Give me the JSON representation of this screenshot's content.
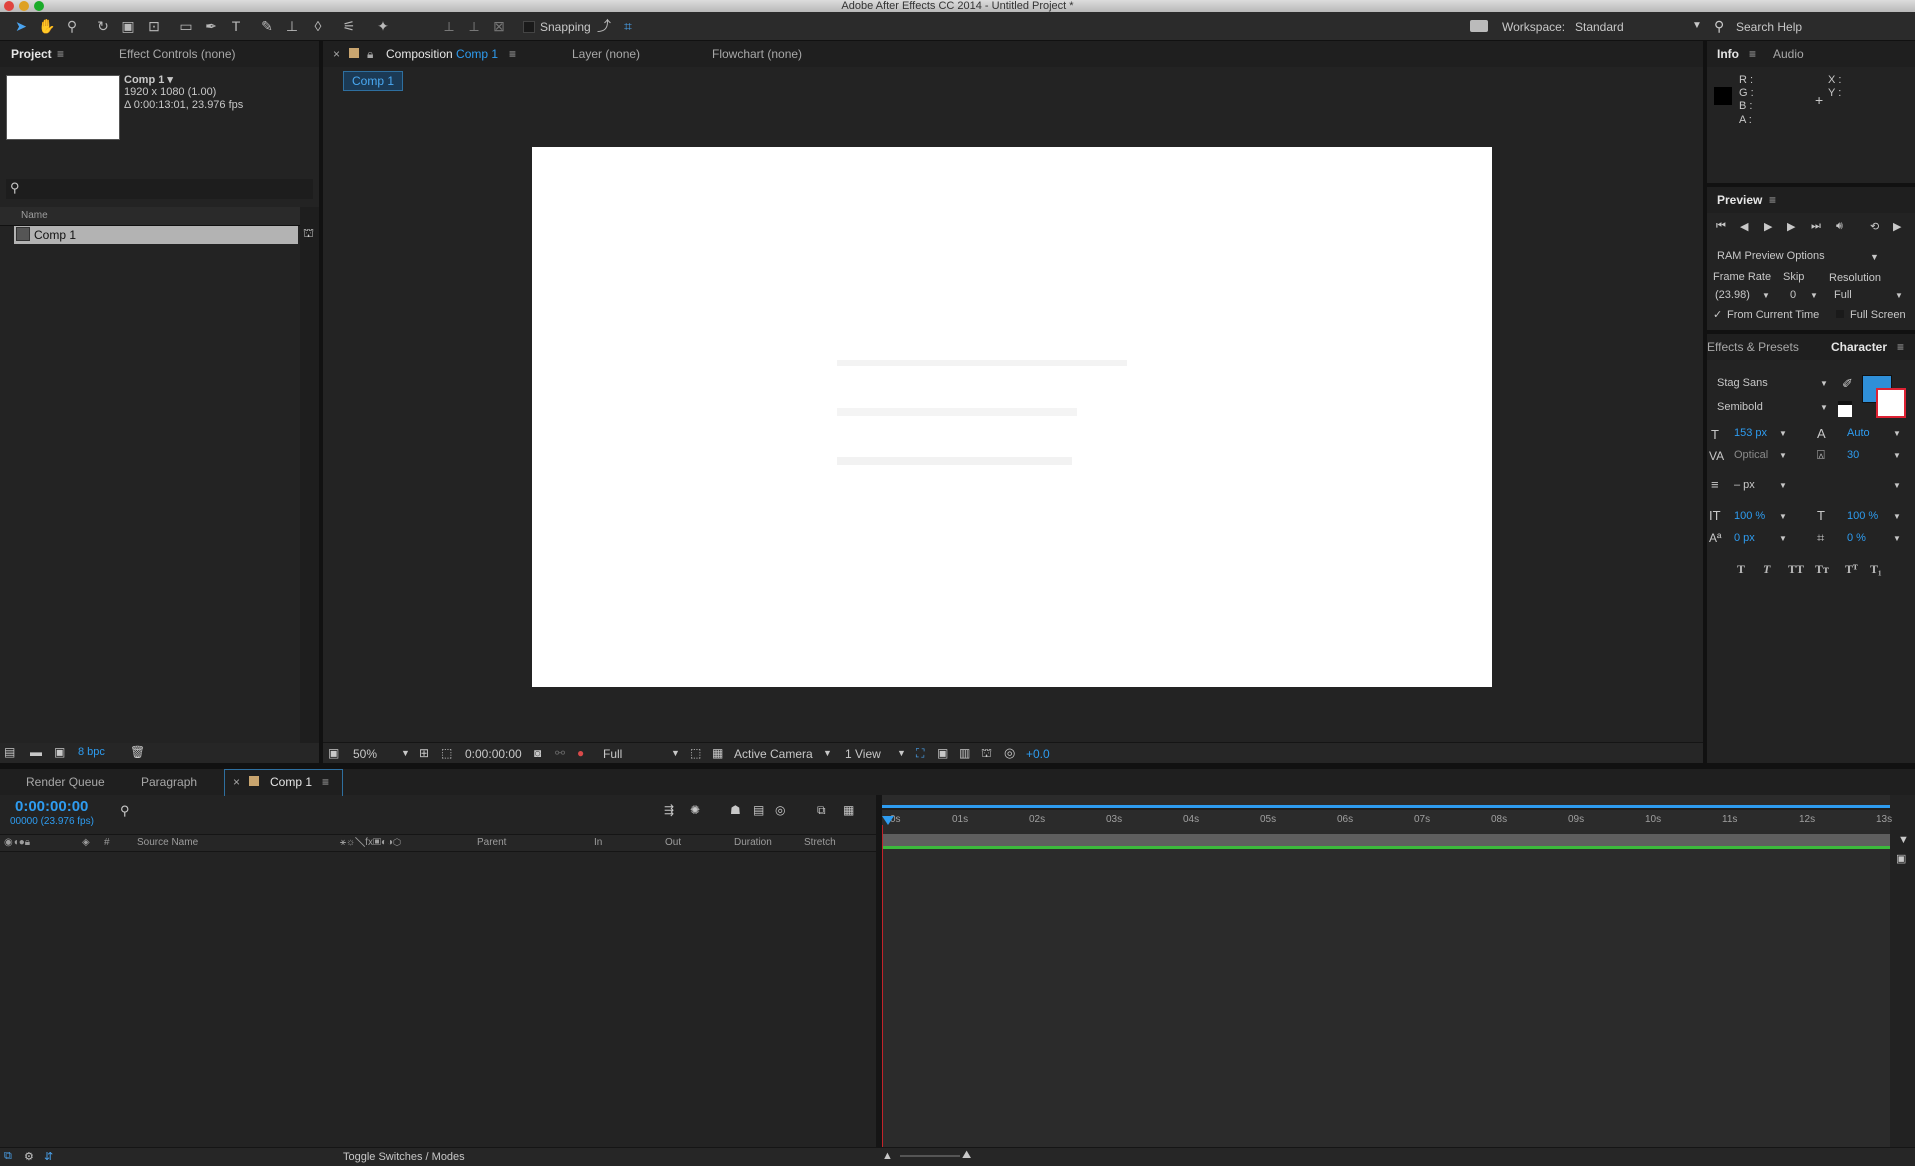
{
  "app": {
    "title": "Adobe After Effects CC 2014 - Untitled Project *"
  },
  "toolbar": {
    "snapping_label": "Snapping",
    "workspace_label": "Workspace:",
    "workspace_value": "Standard",
    "search_help": "Search Help"
  },
  "project": {
    "tab_project": "Project",
    "tab_effect_controls": "Effect Controls (none)",
    "comp_name": "Comp 1 ▾",
    "comp_res": "1920 x 1080 (1.00)",
    "comp_duration": "Δ 0:00:13:01, 23.976 fps",
    "column_name": "Name",
    "items": [
      "Comp 1"
    ],
    "bpc": "8 bpc"
  },
  "viewer": {
    "tab_composition_prefix": "Composition",
    "tab_composition_name": "Comp 1",
    "tab_layer": "Layer (none)",
    "tab_flowchart": "Flowchart (none)",
    "breadcrumb": "Comp 1",
    "zoom": "50%",
    "timecode": "0:00:00:00",
    "resolution": "Full",
    "camera": "Active Camera",
    "views": "1 View",
    "exposure": "+0.0"
  },
  "info": {
    "tab_info": "Info",
    "tab_audio": "Audio",
    "r": "R :",
    "g": "G :",
    "b": "B :",
    "a": "A :",
    "x": "X :",
    "y": "Y :"
  },
  "preview": {
    "title": "Preview",
    "ram_options": "RAM Preview Options",
    "frame_rate_label": "Frame Rate",
    "skip_label": "Skip",
    "resolution_label": "Resolution",
    "frame_rate_value": "(23.98)",
    "skip_value": "0",
    "resolution_value": "Full",
    "from_current": "From Current Time",
    "full_screen": "Full Screen"
  },
  "character": {
    "tab_effects": "Effects & Presets",
    "tab_character": "Character",
    "font": "Stag Sans",
    "style": "Semibold",
    "size": "153 px",
    "leading": "Auto",
    "kerning": "Optical",
    "tracking": "30",
    "stroke": "– px",
    "vscale": "100 %",
    "hscale": "100 %",
    "baseline": "0 px",
    "tsume": "0 %",
    "fill_color": "#2f8fd8"
  },
  "timeline": {
    "tab_render_queue": "Render Queue",
    "tab_paragraph": "Paragraph",
    "tab_comp": "Comp 1",
    "timecode": "0:00:00:00",
    "frames": "00000 (23.976 fps)",
    "col_source": "Source Name",
    "col_parent": "Parent",
    "col_in": "In",
    "col_out": "Out",
    "col_duration": "Duration",
    "col_stretch": "Stretch",
    "toggle_label": "Toggle Switches / Modes",
    "ruler": [
      "0s",
      "01s",
      "02s",
      "03s",
      "04s",
      "05s",
      "06s",
      "07s",
      "08s",
      "09s",
      "10s",
      "11s",
      "12s",
      "13s"
    ]
  }
}
